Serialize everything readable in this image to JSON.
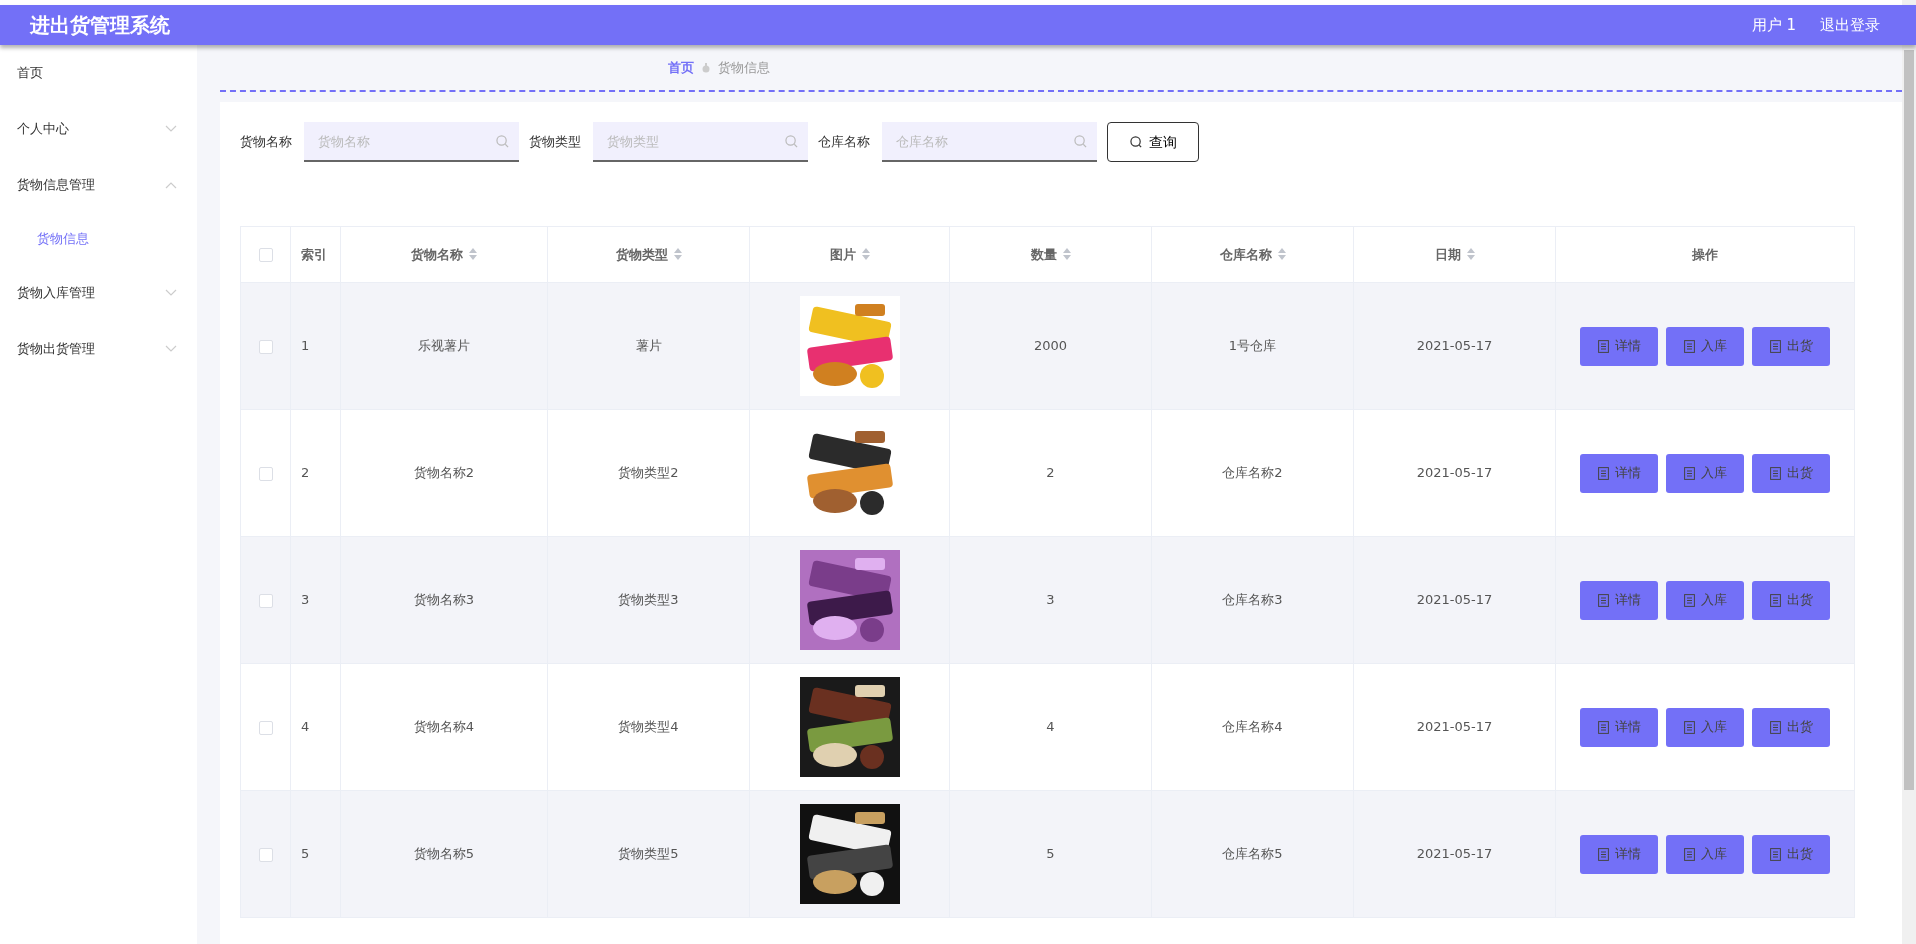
{
  "header": {
    "title": "进出货管理系统",
    "user": "用户 1",
    "logout": "退出登录"
  },
  "sidebar": {
    "items": [
      {
        "label": "首页",
        "kind": "link"
      },
      {
        "label": "个人中心",
        "kind": "group",
        "expanded": false
      },
      {
        "label": "货物信息管理",
        "kind": "group",
        "expanded": true,
        "children": [
          {
            "label": "货物信息",
            "selected": true
          }
        ]
      },
      {
        "label": "货物入库管理",
        "kind": "group",
        "expanded": false
      },
      {
        "label": "货物出货管理",
        "kind": "group",
        "expanded": false
      }
    ]
  },
  "breadcrumb": [
    "首页",
    "货物信息"
  ],
  "search": {
    "fields": [
      {
        "label": "货物名称",
        "placeholder": "货物名称"
      },
      {
        "label": "货物类型",
        "placeholder": "货物类型"
      },
      {
        "label": "仓库名称",
        "placeholder": "仓库名称"
      }
    ],
    "button": "查询"
  },
  "table": {
    "select_all": {
      "checked": false
    },
    "columns": [
      {
        "label": "索引",
        "sortable": false
      },
      {
        "label": "货物名称",
        "sortable": true
      },
      {
        "label": "货物类型",
        "sortable": true
      },
      {
        "label": "图片",
        "sortable": true
      },
      {
        "label": "数量",
        "sortable": true
      },
      {
        "label": "仓库名称",
        "sortable": true
      },
      {
        "label": "日期",
        "sortable": true
      },
      {
        "label": "操作",
        "sortable": false
      }
    ],
    "rows": [
      {
        "checked": false,
        "index": "1",
        "name": "乐视薯片",
        "type": "薯片",
        "quantity": "2000",
        "warehouse": "1号仓库",
        "date": "2021-05-17",
        "actions": [
          "详情",
          "入库",
          "出货"
        ]
      },
      {
        "checked": false,
        "index": "2",
        "name": "货物名称2",
        "type": "货物类型2",
        "quantity": "2",
        "warehouse": "仓库名称2",
        "date": "2021-05-17",
        "actions": [
          "详情",
          "入库",
          "出货"
        ]
      },
      {
        "checked": false,
        "index": "3",
        "name": "货物名称3",
        "type": "货物类型3",
        "quantity": "3",
        "warehouse": "仓库名称3",
        "date": "2021-05-17",
        "actions": [
          "详情",
          "入库",
          "出货"
        ]
      },
      {
        "checked": false,
        "index": "4",
        "name": "货物名称4",
        "type": "货物类型4",
        "quantity": "4",
        "warehouse": "仓库名称4",
        "date": "2021-05-17",
        "actions": [
          "详情",
          "入库",
          "出货"
        ]
      },
      {
        "checked": false,
        "index": "5",
        "name": "货物名称5",
        "type": "货物类型5",
        "quantity": "5",
        "warehouse": "仓库名称5",
        "date": "2021-05-17",
        "actions": [
          "详情",
          "入库",
          "出货"
        ]
      }
    ]
  }
}
